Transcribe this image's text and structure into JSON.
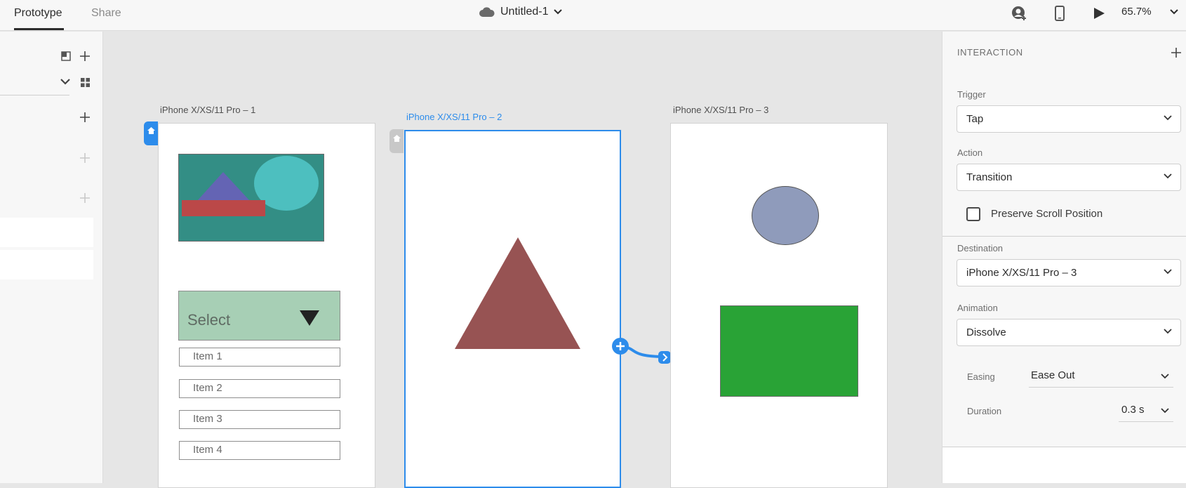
{
  "topbar": {
    "tabs": [
      {
        "label": "Prototype",
        "active": true
      },
      {
        "label": "Share",
        "active": false
      }
    ],
    "doc_title": "Untitled-1",
    "zoom": "65.7%",
    "icons": [
      "cloud-icon",
      "chevron-down-icon",
      "user-icon",
      "device-preview-icon",
      "play-icon",
      "chevron-down-icon"
    ]
  },
  "left_panel": {
    "icons": [
      "copy-icon",
      "add-icon",
      "chevron-down-icon",
      "grid-icon",
      "add-icon",
      "add-icon",
      "add-icon"
    ]
  },
  "artboards": [
    {
      "label": "iPhone X/XS/11 Pro – 1",
      "home": true,
      "select_text": "Select",
      "items": [
        "Item 1",
        "Item 2",
        "Item 3",
        "Item 4"
      ]
    },
    {
      "label": "iPhone X/XS/11 Pro – 2",
      "selected": true
    },
    {
      "label": "iPhone X/XS/11 Pro – 3"
    }
  ],
  "interaction_panel": {
    "title": "INTERACTION",
    "trigger": {
      "label": "Trigger",
      "value": "Tap"
    },
    "action": {
      "label": "Action",
      "value": "Transition"
    },
    "preserve_scroll": {
      "label": "Preserve Scroll Position",
      "checked": false
    },
    "destination": {
      "label": "Destination",
      "value": "iPhone X/XS/11 Pro – 3"
    },
    "animation": {
      "label": "Animation",
      "value": "Dissolve"
    },
    "easing": {
      "label": "Easing",
      "value": "Ease Out"
    },
    "duration": {
      "label": "Duration",
      "value": "0.3 s"
    }
  },
  "colors": {
    "accent": "#2d8ceb",
    "teal_bg": "#338e85",
    "purple_triangle": "#6464b4",
    "cyan_ellipse": "#4dbfbf",
    "red_rect": "#bb4848",
    "select_fill": "#a7cfb5",
    "maroon_triangle": "#975353",
    "slate_ellipse": "#8f9bbb",
    "green_rect": "#29a336"
  }
}
